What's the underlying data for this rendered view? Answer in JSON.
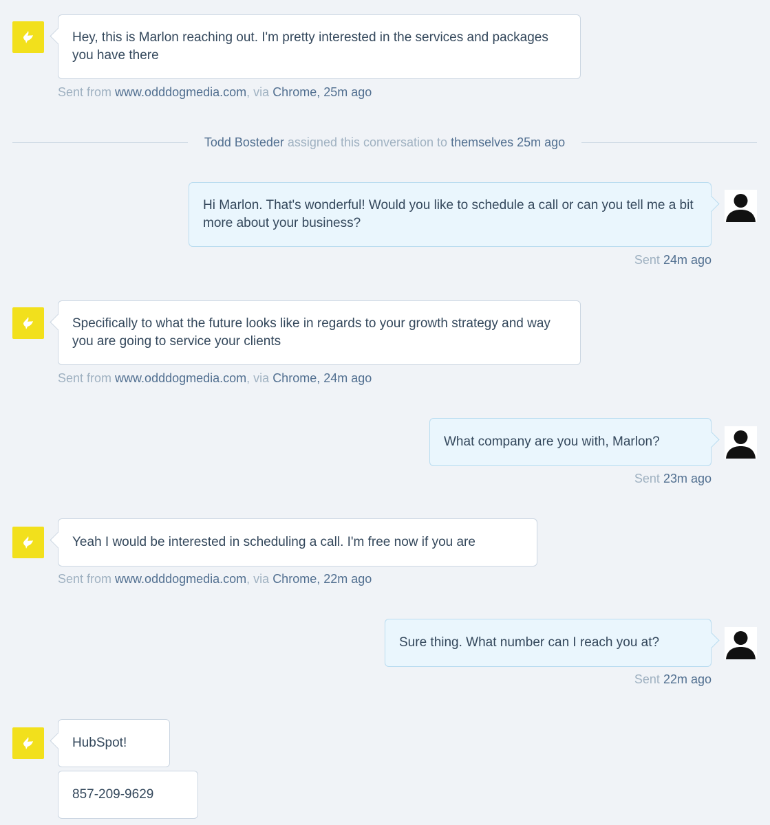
{
  "messages": {
    "m1": {
      "text": "Hey, this is Marlon reaching out. I'm pretty interested in the services and packages you have there",
      "meta": {
        "sent_from": "Sent from",
        "site": "www.odddogmedia.com",
        "via": ", via",
        "browser": "Chrome",
        "time": ", 25m ago"
      }
    },
    "m2": {
      "text": "Hi Marlon. That's wonderful! Would you like to schedule a call or can you tell me a bit more about your business?",
      "meta": {
        "sent": "Sent",
        "time": "24m ago"
      }
    },
    "m3": {
      "text": "Specifically to what the future looks like in regards to your growth strategy and way you are going to service your clients",
      "meta": {
        "sent_from": "Sent from",
        "site": "www.odddogmedia.com",
        "via": ", via",
        "browser": "Chrome",
        "time": ", 24m ago"
      }
    },
    "m4": {
      "text": "What company are you with, Marlon?",
      "meta": {
        "sent": "Sent",
        "time": "23m ago"
      }
    },
    "m5": {
      "text": "Yeah I would be interested in scheduling a call. I'm free now if you are",
      "meta": {
        "sent_from": "Sent from",
        "site": "www.odddogmedia.com",
        "via": ", via",
        "browser": "Chrome",
        "time": ", 22m ago"
      }
    },
    "m6": {
      "text": "Sure thing. What number can I reach you at?",
      "meta": {
        "sent": "Sent",
        "time": "22m ago"
      }
    },
    "m7": {
      "text": "HubSpot!"
    },
    "m8": {
      "text": "857-209-9629"
    }
  },
  "assignment": {
    "agent": "Todd Bosteder",
    "action": "assigned this conversation to",
    "target": "themselves",
    "time": "25m ago"
  },
  "icons": {
    "visitor_avatar": "bird-logo-icon",
    "agent_avatar": "user-silhouette-icon"
  },
  "colors": {
    "background": "#f0f3f7",
    "visitor_avatar_bg": "#f2e01c",
    "agent_bubble_bg": "#eaf6fd",
    "visitor_bubble_bg": "#ffffff",
    "meta_muted": "#9fb1c1",
    "meta_strong": "#516f90"
  }
}
